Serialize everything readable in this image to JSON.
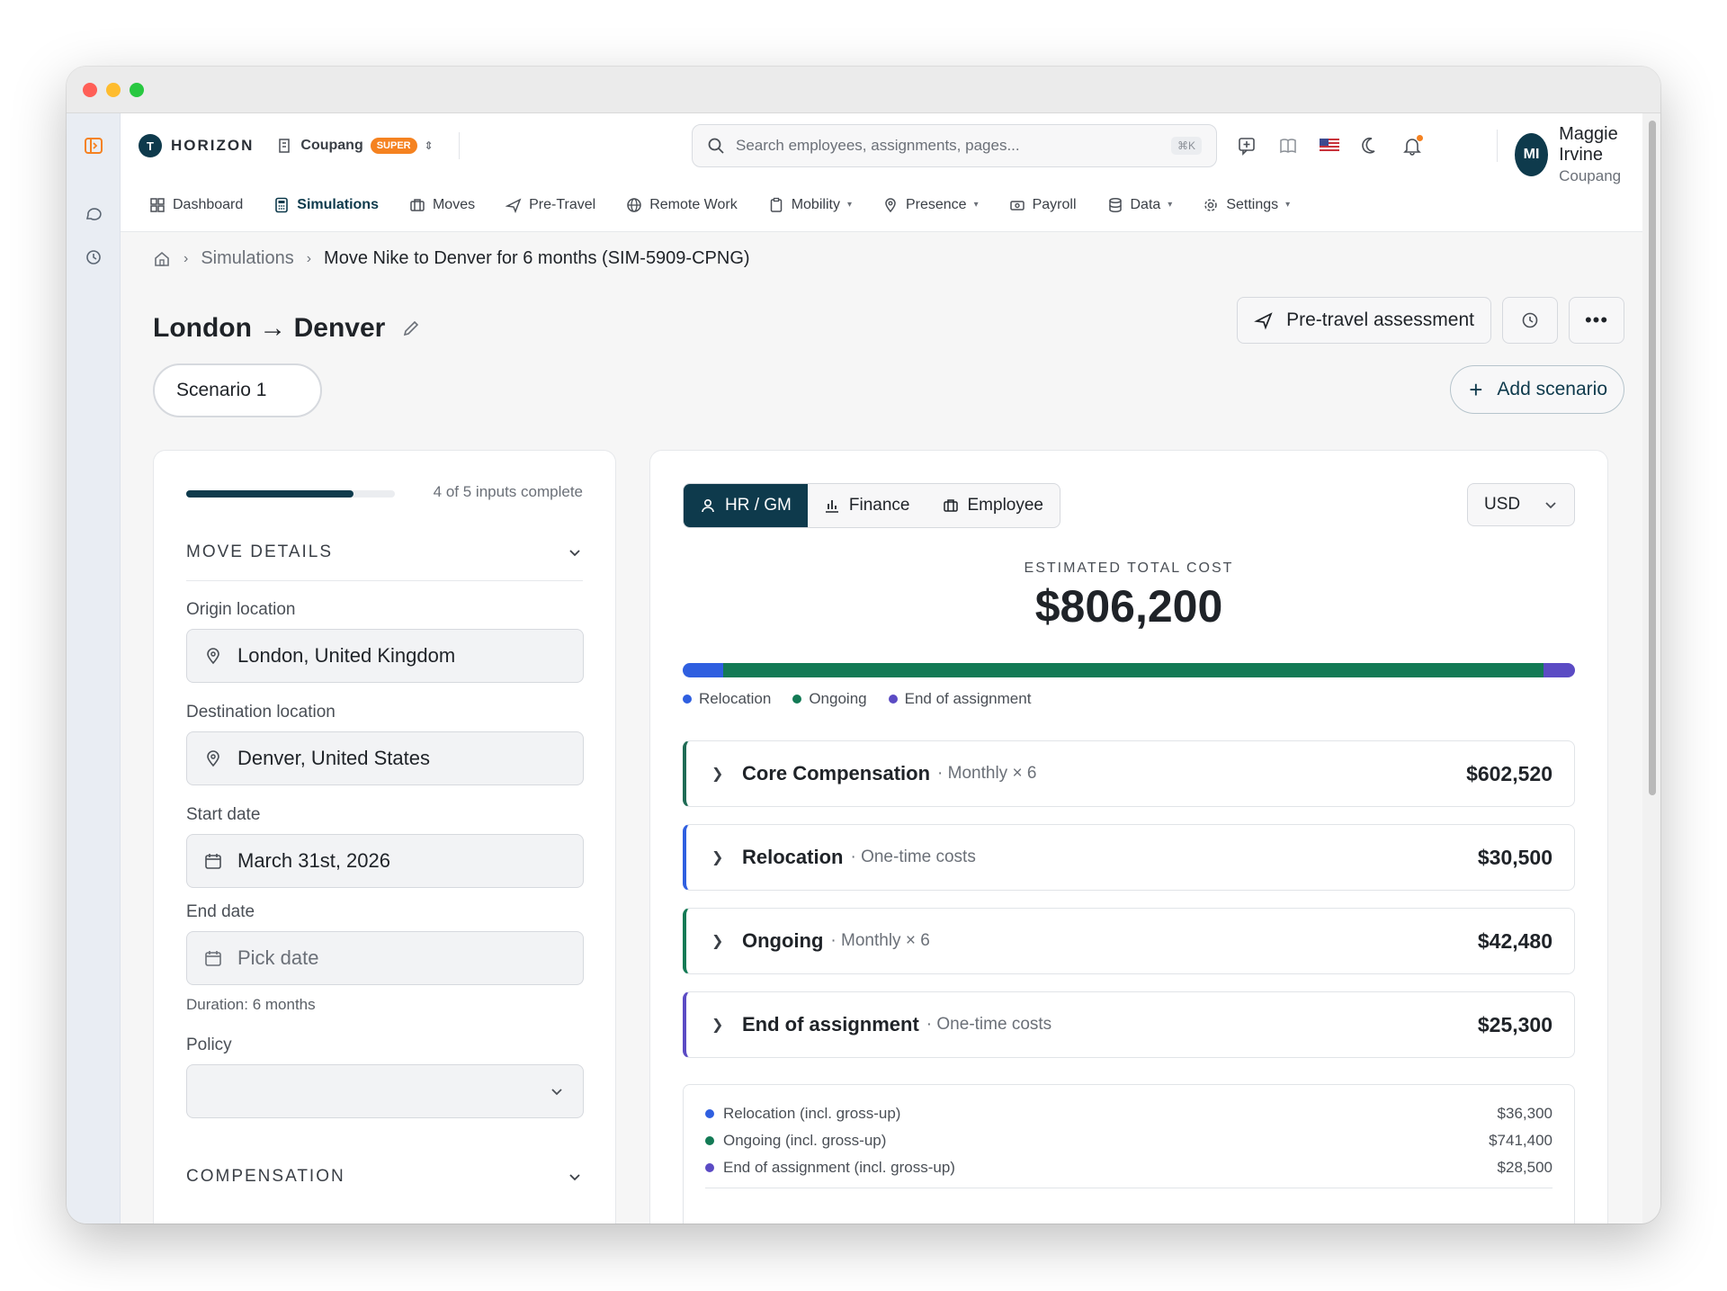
{
  "header": {
    "logo": "HORIZON",
    "logo_mark": "T",
    "company": "Coupang",
    "badge": "SUPER",
    "search_placeholder": "Search employees, assignments, pages...",
    "search_shortcut": "⌘K",
    "user": {
      "initials": "MI",
      "name": "Maggie Irvine",
      "org": "Coupang"
    }
  },
  "nav": [
    {
      "label": "Dashboard",
      "icon": "grid-icon"
    },
    {
      "label": "Simulations",
      "icon": "calculator-icon",
      "active": true
    },
    {
      "label": "Moves",
      "icon": "briefcase-icon"
    },
    {
      "label": "Pre-Travel",
      "icon": "plane-icon"
    },
    {
      "label": "Remote Work",
      "icon": "globe-icon"
    },
    {
      "label": "Mobility",
      "icon": "clipboard-icon",
      "dropdown": true
    },
    {
      "label": "Presence",
      "icon": "pin-icon",
      "dropdown": true
    },
    {
      "label": "Payroll",
      "icon": "money-icon"
    },
    {
      "label": "Data",
      "icon": "database-icon",
      "dropdown": true
    },
    {
      "label": "Settings",
      "icon": "gear-icon",
      "dropdown": true
    }
  ],
  "breadcrumb": {
    "section": "Simulations",
    "current": "Move Nike to Denver for 6 months (SIM-5909-CPNG)"
  },
  "page": {
    "title": "London → Denver",
    "pretravel_button": "Pre-travel assessment",
    "scenario_tab": "Scenario 1",
    "add_scenario": "Add scenario"
  },
  "inputs": {
    "progress_fraction": 0.8,
    "progress_text": "4 of 5 inputs complete",
    "move_details_heading": "MOVE DETAILS",
    "origin_label": "Origin location",
    "origin_value": "London, United Kingdom",
    "destination_label": "Destination location",
    "destination_value": "Denver, United States",
    "start_label": "Start date",
    "start_value": "March 31st, 2026",
    "end_label": "End date",
    "end_placeholder": "Pick date",
    "duration": "Duration: 6 months",
    "policy_label": "Policy",
    "compensation_heading": "COMPENSATION"
  },
  "costs": {
    "views": [
      {
        "label": "HR / GM",
        "icon": "user-icon",
        "active": true
      },
      {
        "label": "Finance",
        "icon": "bar-chart-icon"
      },
      {
        "label": "Employee",
        "icon": "briefcase-icon"
      }
    ],
    "currency": "USD",
    "estimated_label": "ESTIMATED TOTAL COST",
    "estimated_total": "$806,200",
    "colors": {
      "relocation": "#2f5fe0",
      "ongoing": "#137a55",
      "end": "#5b4bc4",
      "core": "#1f6b55"
    },
    "breakdown": [
      {
        "name": "Relocation",
        "value": 36300
      },
      {
        "name": "Ongoing",
        "value": 741400
      },
      {
        "name": "End of assignment",
        "value": 28500
      }
    ],
    "legend": [
      "Relocation",
      "Ongoing",
      "End of assignment"
    ],
    "rows": [
      {
        "title": "Core Compensation",
        "sub": "· Monthly × 6",
        "amount": "$602,520"
      },
      {
        "title": "Relocation",
        "sub": "· One-time costs",
        "amount": "$30,500"
      },
      {
        "title": "Ongoing",
        "sub": "· Monthly × 6",
        "amount": "$42,480"
      },
      {
        "title": "End of assignment",
        "sub": "· One-time costs",
        "amount": "$25,300"
      }
    ],
    "summary": [
      {
        "label": "Relocation (incl. gross-up)",
        "amount": "$36,300"
      },
      {
        "label": "Ongoing (incl. gross-up)",
        "amount": "$741,400"
      },
      {
        "label": "End of assignment (incl. gross-up)",
        "amount": "$28,500"
      }
    ]
  }
}
